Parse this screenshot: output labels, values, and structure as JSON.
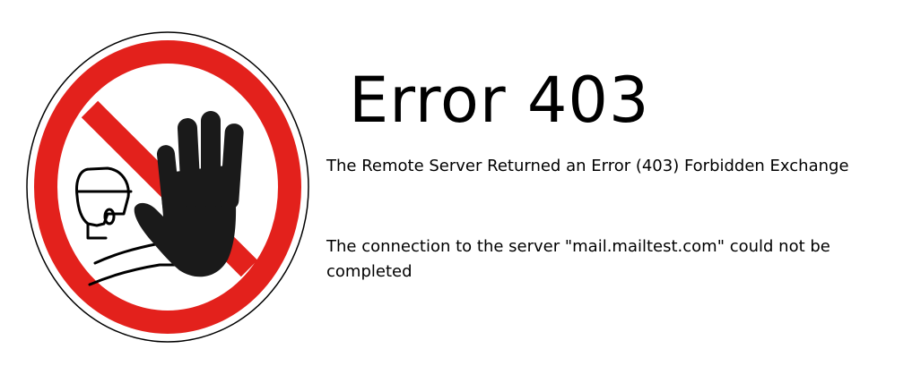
{
  "error": {
    "title": "Error 403",
    "subtitle": "The Remote Server Returned an Error (403) Forbidden Exchange",
    "message": "The connection to the server \"mail.mailtest.com\" could not be completed"
  },
  "sign": {
    "icon": "no-entry-stop-hand-icon",
    "ring_color": "#e3211c",
    "hand_color": "#1a1a1a"
  }
}
